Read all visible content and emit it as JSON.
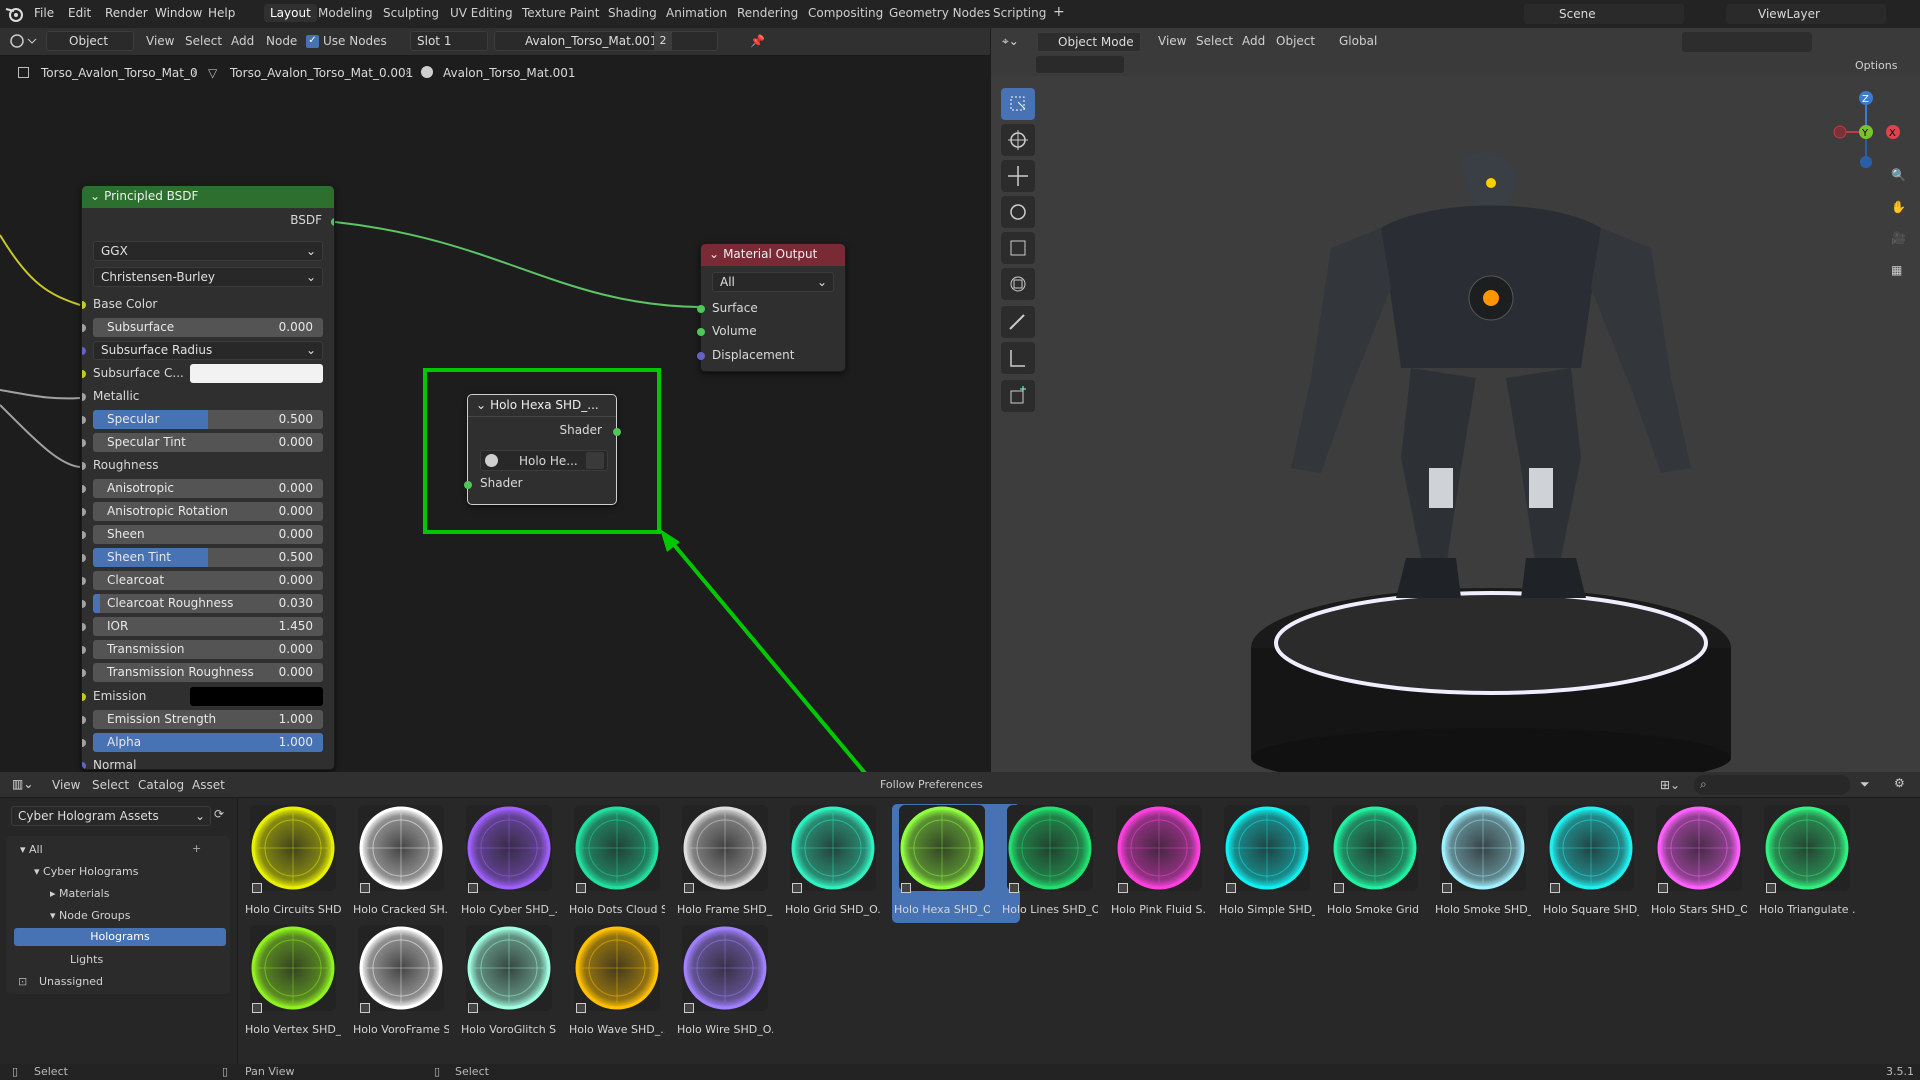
{
  "menu": [
    "File",
    "Edit",
    "Render",
    "Window",
    "Help"
  ],
  "workspaces": [
    "Layout",
    "Modeling",
    "Sculpting",
    "UV Editing",
    "Texture Paint",
    "Shading",
    "Animation",
    "Rendering",
    "Compositing",
    "Geometry Nodes",
    "Scripting"
  ],
  "scene": "Scene",
  "viewlayer": "ViewLayer",
  "node_header": {
    "mode": "Object",
    "view": "View",
    "select": "Select",
    "add": "Add",
    "node": "Node",
    "use_nodes": "Use Nodes",
    "slot": "Slot 1",
    "material": "Avalon_Torso_Mat.001",
    "users": "2"
  },
  "breadcrumb": [
    "Torso_Avalon_Torso_Mat_0",
    "Torso_Avalon_Torso_Mat_0.001",
    "Avalon_Torso_Mat.001"
  ],
  "bsdf": {
    "title": "Principled BSDF",
    "out": "BSDF",
    "dist": "GGX",
    "sss": "Christensen-Burley",
    "rows": [
      [
        "Base Color",
        ""
      ],
      [
        "Subsurface",
        "0.000"
      ],
      [
        "Subsurface Radius",
        ""
      ],
      [
        "Subsurface C...",
        ""
      ],
      [
        "Metallic",
        ""
      ],
      [
        "Specular",
        "0.500"
      ],
      [
        "Specular Tint",
        "0.000"
      ],
      [
        "Roughness",
        ""
      ],
      [
        "Anisotropic",
        "0.000"
      ],
      [
        "Anisotropic Rotation",
        "0.000"
      ],
      [
        "Sheen",
        "0.000"
      ],
      [
        "Sheen Tint",
        "0.500"
      ],
      [
        "Clearcoat",
        "0.000"
      ],
      [
        "Clearcoat Roughness",
        "0.030"
      ],
      [
        "IOR",
        "1.450"
      ],
      [
        "Transmission",
        "0.000"
      ],
      [
        "Transmission Roughness",
        "0.000"
      ],
      [
        "Emission",
        ""
      ],
      [
        "Emission Strength",
        "1.000"
      ],
      [
        "Alpha",
        "1.000"
      ],
      [
        "Normal",
        ""
      ]
    ]
  },
  "output": {
    "title": "Material Output",
    "target": "All",
    "rows": [
      "Surface",
      "Volume",
      "Displacement"
    ]
  },
  "holo": {
    "title": "Holo Hexa SHD_...",
    "out": "Shader",
    "group": "Holo He...",
    "in": "Shader"
  },
  "viewport_header": {
    "mode": "Object Mode",
    "view": "View",
    "select": "Select",
    "add": "Add",
    "object": "Object",
    "orient": "Global",
    "options": "Options"
  },
  "gizmo": {
    "z": "Z",
    "y": "Y",
    "x": "X"
  },
  "browser": {
    "view": "View",
    "select": "Select",
    "catalog": "Catalog",
    "asset": "Asset",
    "library": "Cyber Hologram Assets",
    "import": "Follow Preferences",
    "tree": [
      "All",
      "Cyber Holograms",
      "Materials",
      "Node Groups",
      "Holograms",
      "Lights",
      "Unassigned"
    ],
    "assets": [
      "Holo Circuits SHD...",
      "Holo Cracked SH...",
      "Holo Cyber SHD_...",
      "Holo Dots Cloud S...",
      "Holo Frame SHD_...",
      "Holo Grid SHD_O...",
      "Holo Hexa SHD_O...",
      "Holo Lines SHD_O...",
      "Holo Pink Fluid S...",
      "Holo Simple SHD_...",
      "Holo Smoke Grid ...",
      "Holo Smoke SHD_...",
      "Holo Square SHD_...",
      "Holo Stars SHD_O...",
      "Holo Triangulate ...",
      "Holo Vertex SHD_...",
      "Holo VoroFrame S...",
      "Holo VoroGlitch S...",
      "Holo Wave SHD_...",
      "Holo Wire SHD_O..."
    ],
    "colors": [
      "#e8f000",
      "#ffffff",
      "#a060ff",
      "#20e0a0",
      "#dddddd",
      "#30f0c0",
      "#90ff40",
      "#20e070",
      "#ff40e0",
      "#10f0f0",
      "#20f0a0",
      "#a0f0ff",
      "#20f0f0",
      "#ff60ff",
      "#30f080",
      "#90f020",
      "#ffffff",
      "#a0ffe0",
      "#ffc000",
      "#a080ff"
    ]
  },
  "status": {
    "select": "Select",
    "pan": "Pan View",
    "select2": "Select",
    "version": "3.5.1"
  },
  "colors": {
    "highlight": "#00c800",
    "accent": "#4772b3"
  }
}
